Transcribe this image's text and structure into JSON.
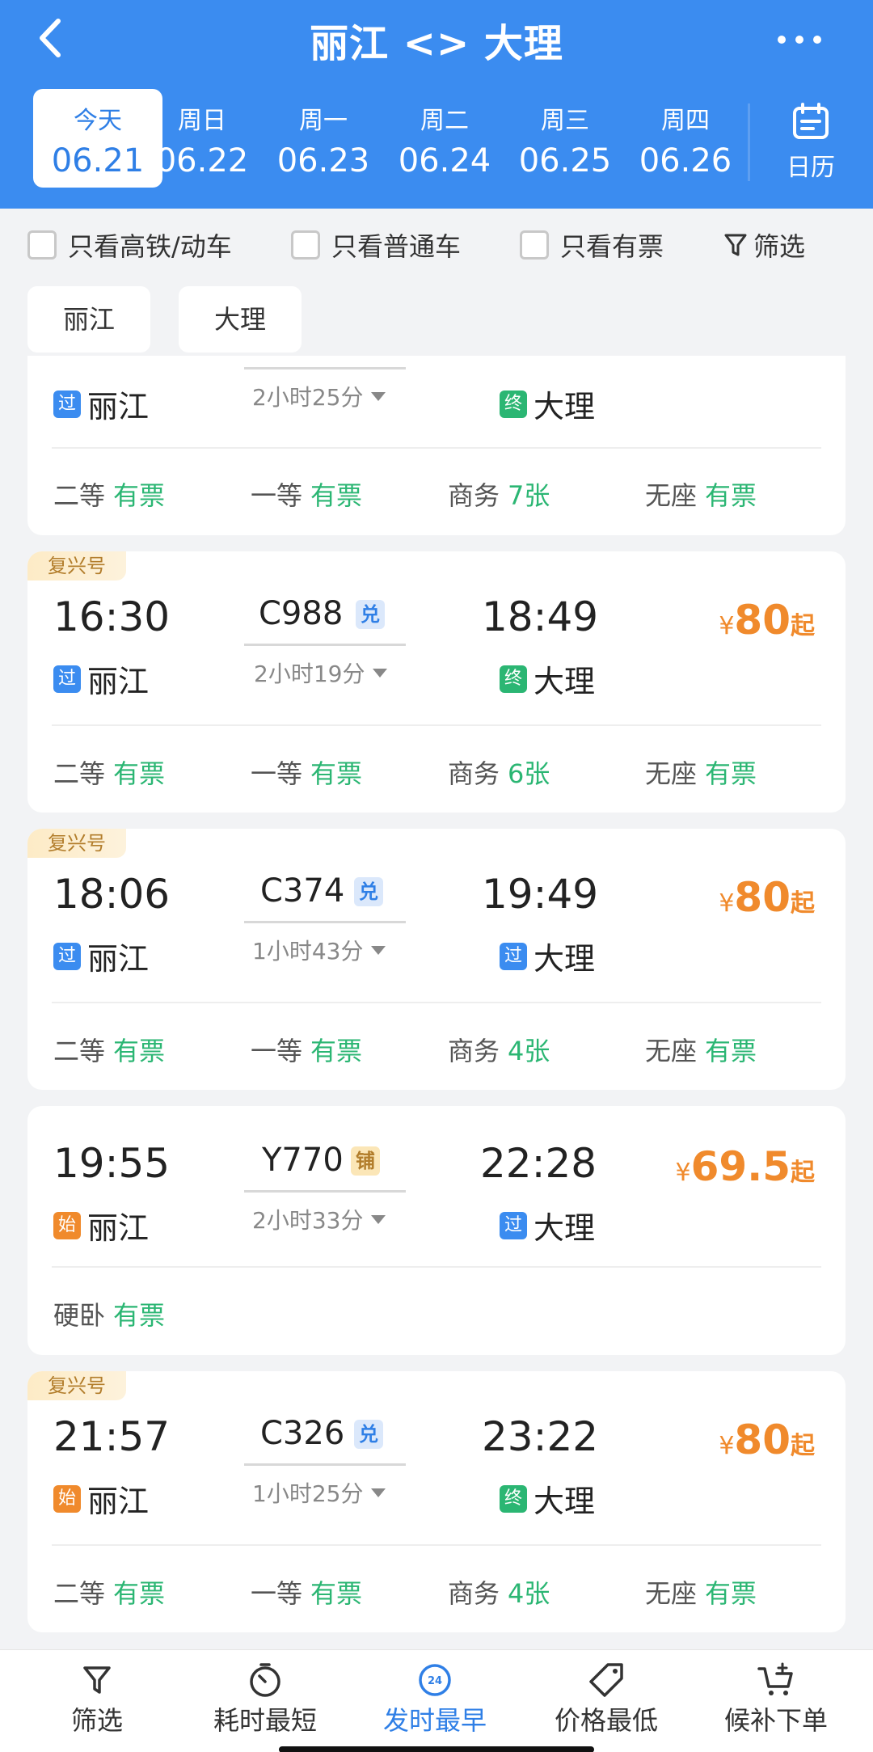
{
  "header": {
    "title": "丽江 <> 大理",
    "accent_color": "#3b8cf0",
    "dates": [
      {
        "weekday": "今天",
        "date": "06.21",
        "active": true
      },
      {
        "weekday": "周日",
        "date": "06.22"
      },
      {
        "weekday": "周一",
        "date": "06.23"
      },
      {
        "weekday": "周二",
        "date": "06.24"
      },
      {
        "weekday": "周三",
        "date": "06.25"
      },
      {
        "weekday": "周四",
        "date": "06.26"
      }
    ],
    "calendar_label": "日历"
  },
  "filters": {
    "high_speed_only": "只看高铁/动车",
    "regular_only": "只看普通车",
    "available_only": "只看有票",
    "filter_label": "筛选"
  },
  "stations": {
    "from": "丽江",
    "to": "大理"
  },
  "trains": [
    {
      "duration": "2小时25分",
      "from_badge": "过",
      "from_station": "丽江",
      "to_badge": "终",
      "to_station": "大理",
      "seats": [
        {
          "class": "二等",
          "status": "有票"
        },
        {
          "class": "一等",
          "status": "有票"
        },
        {
          "class": "商务",
          "status": "7张"
        },
        {
          "class": "无座",
          "status": "有票"
        }
      ]
    },
    {
      "tag": "复兴号",
      "depart": "16:30",
      "train_no": "C988",
      "badge": "兑",
      "arrive": "18:49",
      "duration": "2小时19分",
      "from_badge": "过",
      "from_station": "丽江",
      "to_badge": "终",
      "to_station": "大理",
      "price_yen": "¥",
      "price": "80",
      "price_suffix": "起",
      "seats": [
        {
          "class": "二等",
          "status": "有票"
        },
        {
          "class": "一等",
          "status": "有票"
        },
        {
          "class": "商务",
          "status": "6张"
        },
        {
          "class": "无座",
          "status": "有票"
        }
      ]
    },
    {
      "tag": "复兴号",
      "depart": "18:06",
      "train_no": "C374",
      "badge": "兑",
      "arrive": "19:49",
      "duration": "1小时43分",
      "from_badge": "过",
      "from_station": "丽江",
      "to_badge": "过",
      "to_station": "大理",
      "price_yen": "¥",
      "price": "80",
      "price_suffix": "起",
      "seats": [
        {
          "class": "二等",
          "status": "有票"
        },
        {
          "class": "一等",
          "status": "有票"
        },
        {
          "class": "商务",
          "status": "4张"
        },
        {
          "class": "无座",
          "status": "有票"
        }
      ]
    },
    {
      "depart": "19:55",
      "train_no": "Y770",
      "badge": "铺",
      "arrive": "22:28",
      "duration": "2小时33分",
      "from_badge": "始",
      "from_station": "丽江",
      "to_badge": "过",
      "to_station": "大理",
      "price_yen": "¥",
      "price": "69.5",
      "price_suffix": "起",
      "seats": [
        {
          "class": "硬卧",
          "status": "有票"
        }
      ]
    },
    {
      "tag": "复兴号",
      "depart": "21:57",
      "train_no": "C326",
      "badge": "兑",
      "arrive": "23:22",
      "duration": "1小时25分",
      "from_badge": "始",
      "from_station": "丽江",
      "to_badge": "终",
      "to_station": "大理",
      "price_yen": "¥",
      "price": "80",
      "price_suffix": "起",
      "seats": [
        {
          "class": "二等",
          "status": "有票"
        },
        {
          "class": "一等",
          "status": "有票"
        },
        {
          "class": "商务",
          "status": "4张"
        },
        {
          "class": "无座",
          "status": "有票"
        }
      ]
    }
  ],
  "bottom_nav": [
    {
      "label": "筛选",
      "icon": "filter-icon"
    },
    {
      "label": "耗时最短",
      "icon": "stopwatch-icon"
    },
    {
      "label": "发时最早",
      "icon": "clock-24-icon",
      "icon_text": "24",
      "active": true
    },
    {
      "label": "价格最低",
      "icon": "price-tag-icon"
    },
    {
      "label": "候补下单",
      "icon": "cart-add-icon"
    }
  ]
}
